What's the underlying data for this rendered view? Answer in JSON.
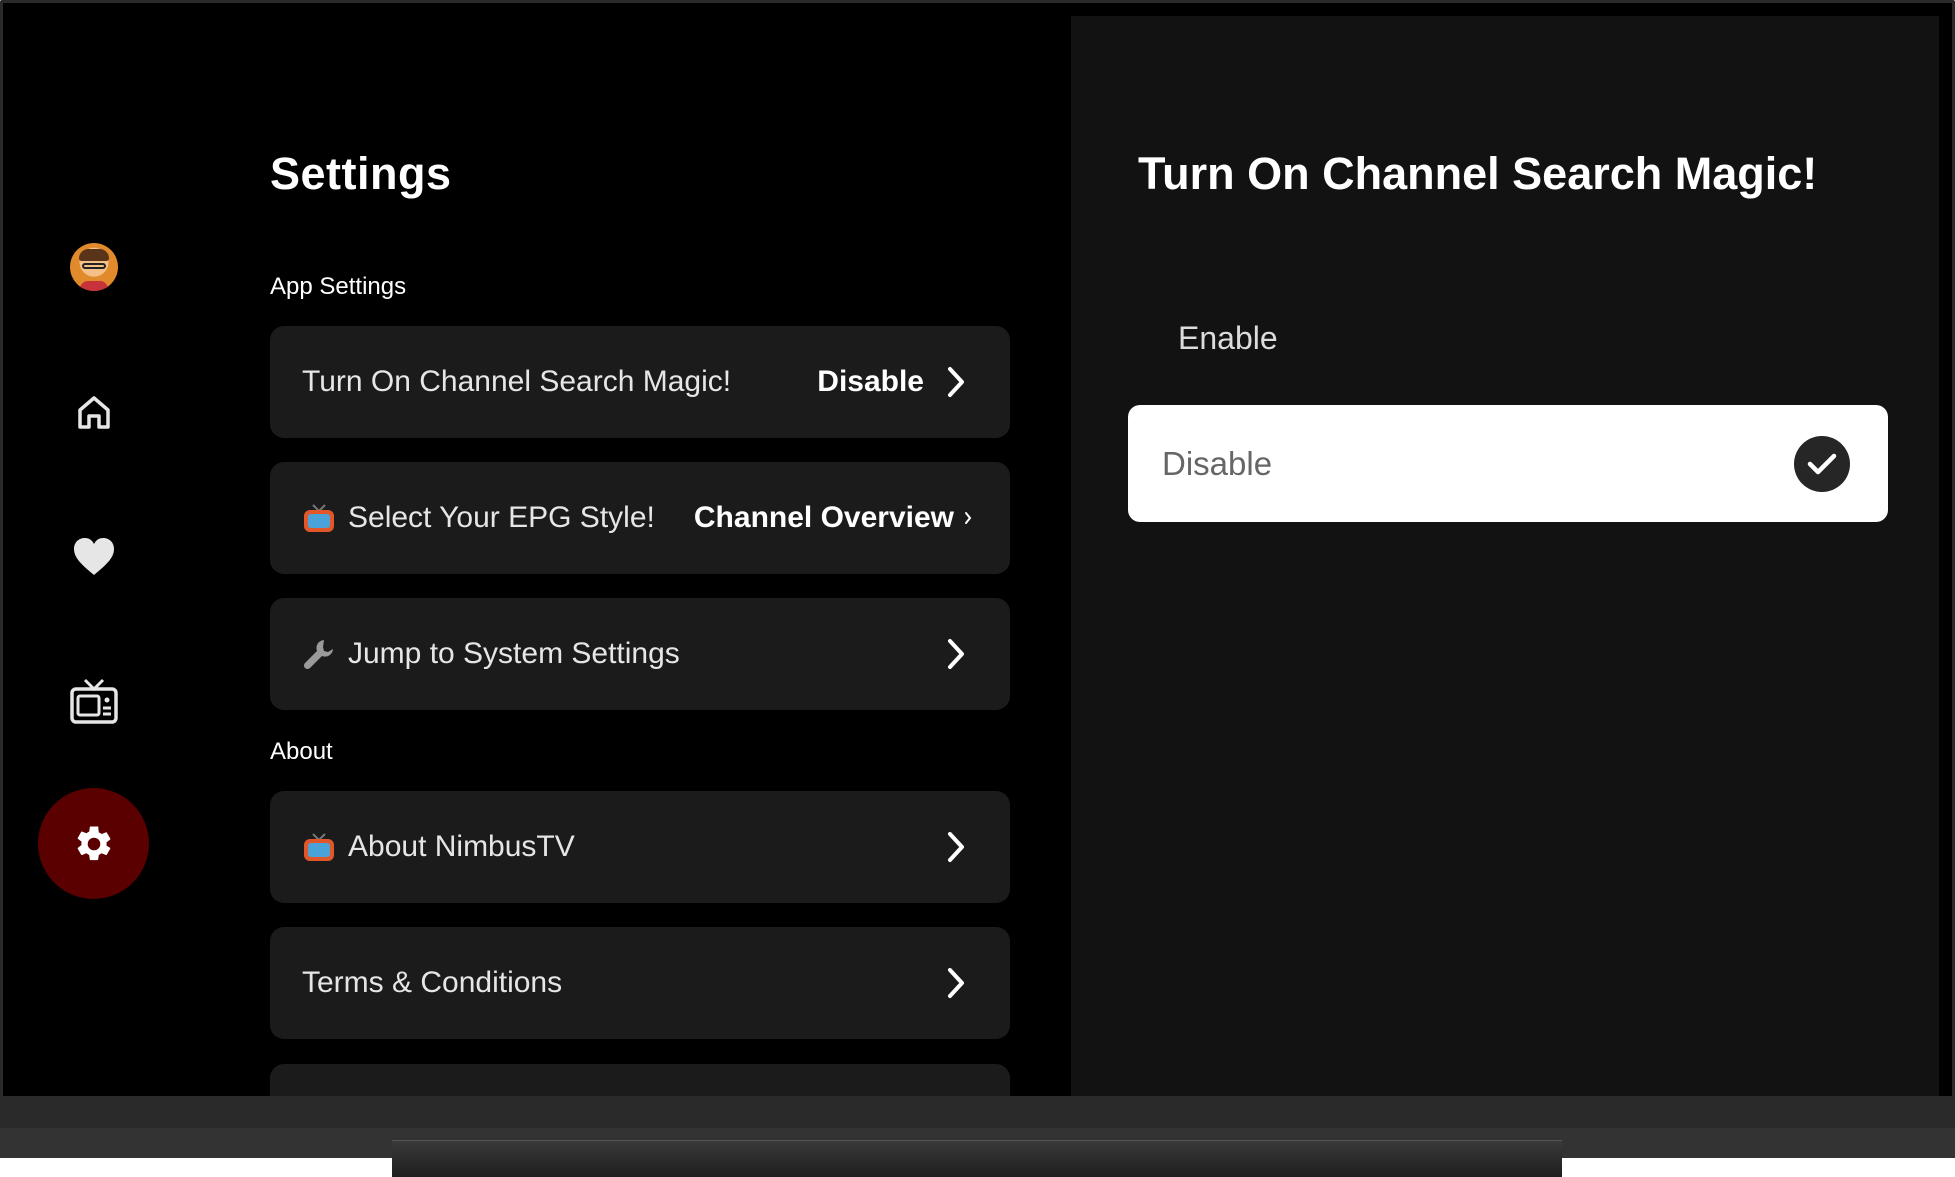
{
  "settings": {
    "title": "Settings",
    "sections": {
      "app_settings": "App Settings",
      "about": "About"
    },
    "rows": {
      "channel_search": {
        "label": "Turn On Channel Search Magic!",
        "value": "Disable"
      },
      "epg_style": {
        "label": "Select Your EPG Style!",
        "value": "Channel Overview",
        "icon": "tv-emoji-icon"
      },
      "system_settings": {
        "label": "Jump to System Settings",
        "icon": "wrench-icon"
      },
      "about_app": {
        "label": "About NimbusTV",
        "icon": "tv-emoji-icon"
      },
      "terms": {
        "label": "Terms & Conditions"
      }
    }
  },
  "nav": {
    "items": [
      "avatar",
      "home-icon",
      "heart-icon",
      "tv-icon",
      "gear-icon"
    ],
    "active": "gear-icon",
    "active_color": "#5a0000"
  },
  "detail": {
    "title": "Turn On Channel Search Magic!",
    "options": [
      {
        "label": "Enable",
        "selected": false
      },
      {
        "label": "Disable",
        "selected": true
      }
    ]
  }
}
